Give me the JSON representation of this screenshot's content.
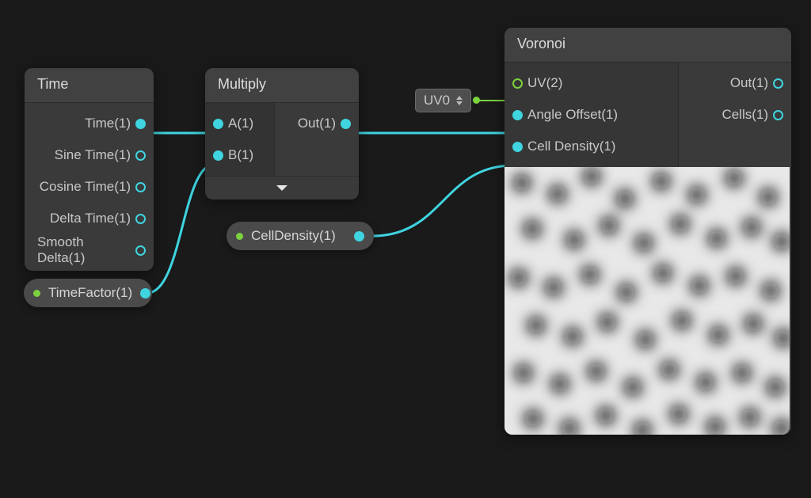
{
  "nodes": {
    "time": {
      "title": "Time",
      "outputs": {
        "time": "Time(1)",
        "sine": "Sine Time(1)",
        "cosine": "Cosine Time(1)",
        "delta": "Delta Time(1)",
        "smooth": "Smooth Delta(1)"
      }
    },
    "multiply": {
      "title": "Multiply",
      "inputs": {
        "a": "A(1)",
        "b": "B(1)"
      },
      "outputs": {
        "out": "Out(1)"
      }
    },
    "voronoi": {
      "title": "Voronoi",
      "inputs": {
        "uv": "UV(2)",
        "angle": "Angle Offset(1)",
        "density": "Cell Density(1)"
      },
      "outputs": {
        "out": "Out(1)",
        "cells": "Cells(1)"
      }
    }
  },
  "pills": {
    "timefactor": "TimeFactor(1)",
    "celldensity": "CellDensity(1)"
  },
  "uvbox": {
    "label": "UV0"
  },
  "colors": {
    "wire": "#3fd4e0",
    "wire_green": "#7bd23f",
    "bg": "#1a1a1a"
  }
}
